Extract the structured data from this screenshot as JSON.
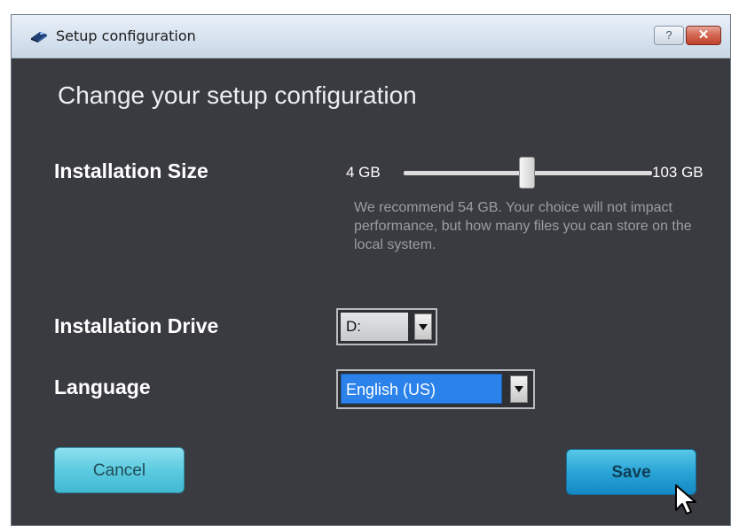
{
  "window": {
    "title": "Setup configuration",
    "help_button": "?",
    "close_button": "✕"
  },
  "main": {
    "heading": "Change your setup configuration"
  },
  "installation_size": {
    "label": "Installation Size",
    "min_label": "4 GB",
    "max_label": "103 GB",
    "min_value": 4,
    "max_value": 103,
    "current_value": 54,
    "recommendation": "We recommend 54 GB. Your choice will not impact performance, but how many files you can store on the local system."
  },
  "installation_drive": {
    "label": "Installation Drive",
    "selected": "D:"
  },
  "language": {
    "label": "Language",
    "selected": "English (US)"
  },
  "buttons": {
    "cancel": "Cancel",
    "save": "Save"
  },
  "colors": {
    "background": "#3a3b40",
    "accent": "#2aa5d6",
    "selection": "#2b82ea"
  }
}
